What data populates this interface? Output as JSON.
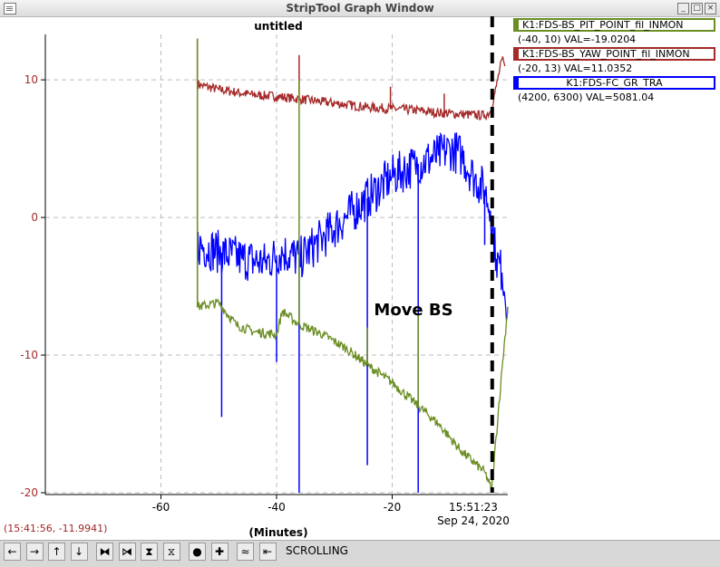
{
  "window": {
    "title": "StripTool Graph Window",
    "min_glyph": "_",
    "max_glyph": "□",
    "close_glyph": "×"
  },
  "plot_title": "untitled",
  "annotation": "Move BS",
  "cursor_readout": "(15:41:56, -11.9941)",
  "toolbar": {
    "mode": "SCROLLING",
    "buttons": [
      {
        "name": "pan-left-button",
        "glyph": "←"
      },
      {
        "name": "pan-right-button",
        "glyph": "→"
      },
      {
        "name": "pan-up-button",
        "glyph": "↑"
      },
      {
        "name": "pan-down-button",
        "glyph": "↓"
      },
      {
        "name": "zoom-in-x-button",
        "glyph": "⧓"
      },
      {
        "name": "zoom-out-x-button",
        "glyph": "⧒"
      },
      {
        "name": "zoom-in-y-button",
        "glyph": "⧗"
      },
      {
        "name": "zoom-out-y-button",
        "glyph": "⧖"
      },
      {
        "name": "reset-button",
        "glyph": "●"
      },
      {
        "name": "auto-scale-button",
        "glyph": "✚"
      },
      {
        "name": "scroll-button",
        "glyph": "≈"
      },
      {
        "name": "refresh-button",
        "glyph": "⇤"
      }
    ]
  },
  "legend": [
    {
      "name": "K1:FDS-BS_PIT_POINT_fil_INMON",
      "readout": "(-40, 10) VAL=-19.0204",
      "color": "#6b8e23"
    },
    {
      "name": "K1:FDS-BS_YAW_POINT_fil_INMON",
      "readout": "(-20, 13) VAL=11.0352",
      "color": "#a52a2a"
    },
    {
      "name": "K1:FDS-FC_GR_TRA",
      "readout": "(4200, 6300) VAL=5081.04",
      "color": "#0000ff"
    }
  ],
  "chart_data": {
    "type": "line",
    "x_unit_label": "(Minutes)",
    "xlim": [
      -80,
      0
    ],
    "ylim": [
      -20,
      13.3
    ],
    "x_ticks": [
      -60,
      -40,
      -20
    ],
    "y_ticks": [
      10,
      0,
      -10,
      -20
    ],
    "y_tick_color": "#a52a2a",
    "end_time": "15:51:23",
    "end_date": "Sep 24, 2020",
    "grid": true,
    "marker_line_x": -2.7,
    "series": [
      {
        "name": "K1:FDS-BS_YAW_POINT_fil_INMON",
        "color": "#a52a2a",
        "x": [
          -53.7,
          -53.7,
          -53,
          -50,
          -47,
          -44,
          -40,
          -36,
          -32,
          -28,
          -24,
          -20,
          -16,
          -12,
          -8,
          -4,
          -3,
          -2,
          -1,
          -0.5
        ],
        "y": [
          13,
          9.7,
          9.6,
          9.3,
          9.1,
          8.9,
          8.8,
          8.6,
          8.4,
          8.2,
          8.0,
          7.9,
          7.8,
          7.6,
          7.5,
          7.4,
          7.7,
          9.5,
          11.5,
          11
        ],
        "spikes": [
          [
            -53.7,
            13
          ],
          [
            -36.1,
            11.8
          ],
          [
            -20.3,
            9.5
          ],
          [
            -11,
            9.0
          ]
        ]
      },
      {
        "name": "K1:FDS-FC_GR_TRA",
        "color": "#0000ff",
        "x": [
          -53.7,
          -53.7,
          -50,
          -46,
          -42,
          -39,
          -36,
          -32,
          -28,
          -24,
          -20,
          -16,
          -12,
          -10,
          -8,
          -6,
          -4,
          -3,
          -2,
          -1,
          0
        ],
        "y": [
          -6.5,
          -2.0,
          -2.5,
          -3.0,
          -3.3,
          -2.5,
          -3.0,
          -1.5,
          0,
          1.5,
          3.0,
          3.8,
          4.5,
          5.0,
          4.5,
          3.0,
          2.0,
          0.5,
          -3.0,
          -4.0,
          -6.5
        ],
        "spikes": [
          [
            -49.5,
            -14.5
          ],
          [
            -40,
            -10.5
          ],
          [
            -36.1,
            -20
          ],
          [
            -24.3,
            -18
          ],
          [
            -15.5,
            -20
          ],
          [
            -4,
            -2
          ]
        ]
      },
      {
        "name": "K1:FDS-BS_PIT_POINT_fil_INMON",
        "color": "#6b8e23",
        "x": [
          -53.7,
          -53.7,
          -50,
          -47,
          -44,
          -40,
          -39,
          -36,
          -32,
          -28,
          -24,
          -20,
          -16,
          -12,
          -8,
          -4,
          -2.8,
          -1,
          0
        ],
        "y": [
          13,
          -6.5,
          -6.2,
          -7.8,
          -8.3,
          -8.5,
          -6.8,
          -7.8,
          -8.5,
          -9.5,
          -10.8,
          -12.0,
          -13.5,
          -15.0,
          -17.0,
          -18.5,
          -19.8,
          -11,
          -6.5
        ],
        "spikes": [
          [
            -53.7,
            13
          ],
          [
            -36.1,
            10
          ],
          [
            -24.3,
            -8
          ],
          [
            -15.5,
            -7
          ]
        ]
      }
    ]
  }
}
